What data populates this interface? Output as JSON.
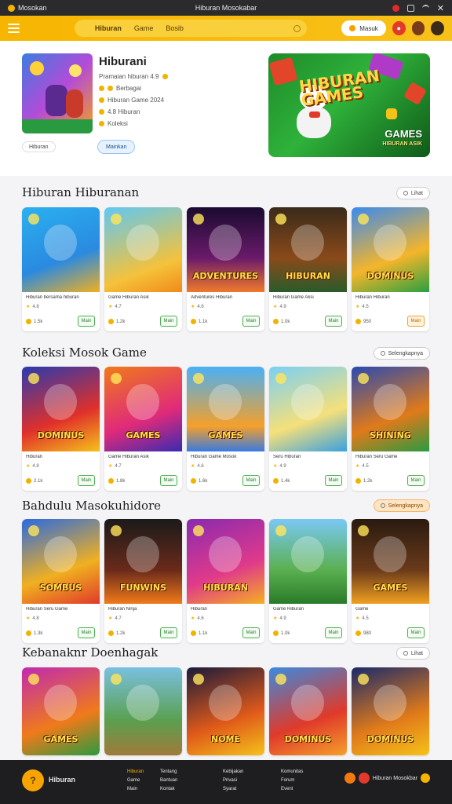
{
  "status_bar": {
    "app_name": "Mosokan",
    "center_text": "Hiburan Mosokabar"
  },
  "header": {
    "brand": "Hiburan",
    "search_parts": [
      "Game",
      "Bosib"
    ],
    "login_label": "Masuk"
  },
  "hero": {
    "title": "Hiburani",
    "lines": [
      "Pramaian hiburan 4.9",
      "Berbagai",
      "Hiburan Game 2024",
      "4.8 Hiburan",
      "Koleksi"
    ],
    "tag_label": "Hiburan",
    "button_label": "Mainkan",
    "banner_title_1": "HIBURAN",
    "banner_title_2": "GAMES",
    "banner_sub": "GAMES",
    "banner_sub_small": "HIBURAN ASIK"
  },
  "sections": [
    {
      "title": "Hiburan Hiburanan",
      "see_label": "Lihat",
      "see_style": "plain",
      "cards": [
        {
          "name": "Hiburan bersama hiburan",
          "meta": "4.8",
          "foot": "1.5k",
          "play": "Main",
          "art": "a",
          "label": ""
        },
        {
          "name": "Game Hiburan Asik",
          "meta": "4.7",
          "foot": "1.2k",
          "play": "Main",
          "art": "b",
          "label": ""
        },
        {
          "name": "Adventures Hiburan",
          "meta": "4.6",
          "foot": "1.1k",
          "play": "Main",
          "art": "c",
          "label": "ADVENTURES"
        },
        {
          "name": "Hiburan Game Aksi",
          "meta": "4.9",
          "foot": "1.0k",
          "play": "Main",
          "art": "d",
          "label": "HIBURAN"
        },
        {
          "name": "Hiburan Hiburan",
          "meta": "4.5",
          "foot": "950",
          "play": "Main",
          "art": "e",
          "label": "DOMINUS"
        }
      ]
    },
    {
      "title": "Koleksi Mosok Game",
      "see_label": "Selengkapnya",
      "see_style": "plain",
      "cards": [
        {
          "name": "Hiburan",
          "meta": "4.8",
          "foot": "2.1k",
          "play": "Main",
          "art": "f",
          "label": "DOMINUS"
        },
        {
          "name": "Game Hiburan Asik",
          "meta": "4.7",
          "foot": "1.8k",
          "play": "Main",
          "art": "g",
          "label": "GAMES"
        },
        {
          "name": "Hiburan Game Mosok",
          "meta": "4.6",
          "foot": "1.6k",
          "play": "Main",
          "art": "h",
          "label": "GAMES"
        },
        {
          "name": "Seru Hiburan",
          "meta": "4.9",
          "foot": "1.4k",
          "play": "Main",
          "art": "i",
          "label": ""
        },
        {
          "name": "Hiburan Seru Game",
          "meta": "4.5",
          "foot": "1.2k",
          "play": "Main",
          "art": "j",
          "label": "SHINING"
        }
      ]
    },
    {
      "title": "Bahdulu Masokuhidore",
      "see_label": "Selengkapnya",
      "see_style": "orange",
      "cards": [
        {
          "name": "Hiburan Seru Game",
          "meta": "4.8",
          "foot": "1.3k",
          "play": "Main",
          "art": "k",
          "label": "SOMBUS"
        },
        {
          "name": "Hiburan Ninja",
          "meta": "4.7",
          "foot": "1.2k",
          "play": "Main",
          "art": "l",
          "label": "FUNWINS"
        },
        {
          "name": "Hiburan",
          "meta": "4.6",
          "foot": "1.1k",
          "play": "Main",
          "art": "m",
          "label": "HIBURAN"
        },
        {
          "name": "Game Hiburan",
          "meta": "4.9",
          "foot": "1.0k",
          "play": "Main",
          "art": "n",
          "label": ""
        },
        {
          "name": "Game",
          "meta": "4.5",
          "foot": "980",
          "play": "Main",
          "art": "o",
          "label": "GAMES"
        }
      ]
    },
    {
      "title": "Kebanaknr Doenhagak",
      "see_label": "Lihat",
      "see_style": "plain",
      "cards": [
        {
          "name": "",
          "meta": "",
          "foot": "",
          "play": "",
          "art": "p",
          "label": "GAMES"
        },
        {
          "name": "",
          "meta": "",
          "foot": "",
          "play": "",
          "art": "q",
          "label": ""
        },
        {
          "name": "",
          "meta": "",
          "foot": "",
          "play": "",
          "art": "r",
          "label": "NOME"
        },
        {
          "name": "",
          "meta": "",
          "foot": "",
          "play": "",
          "art": "s",
          "label": "DOMINUS"
        },
        {
          "name": "",
          "meta": "",
          "foot": "",
          "play": "",
          "art": "t",
          "label": "DOMINUS"
        }
      ]
    }
  ],
  "footer": {
    "brand": "Hiburan",
    "columns": [
      {
        "heading": "Hiburan",
        "items": [
          "Game",
          "Main"
        ]
      },
      {
        "heading": "Tentang",
        "items": [
          "Bantuan",
          "Kontak"
        ]
      },
      {
        "heading": "Kebijakan",
        "items": [
          "Privasi",
          "Syarat"
        ]
      },
      {
        "heading": "Komunitas",
        "items": [
          "Forum",
          "Event"
        ]
      }
    ],
    "right_label": "Hiburan Mosokbar"
  },
  "colors": {
    "accent": "#f7b500",
    "play_green": "#4caf50",
    "footer_bg": "#1e1e20"
  }
}
